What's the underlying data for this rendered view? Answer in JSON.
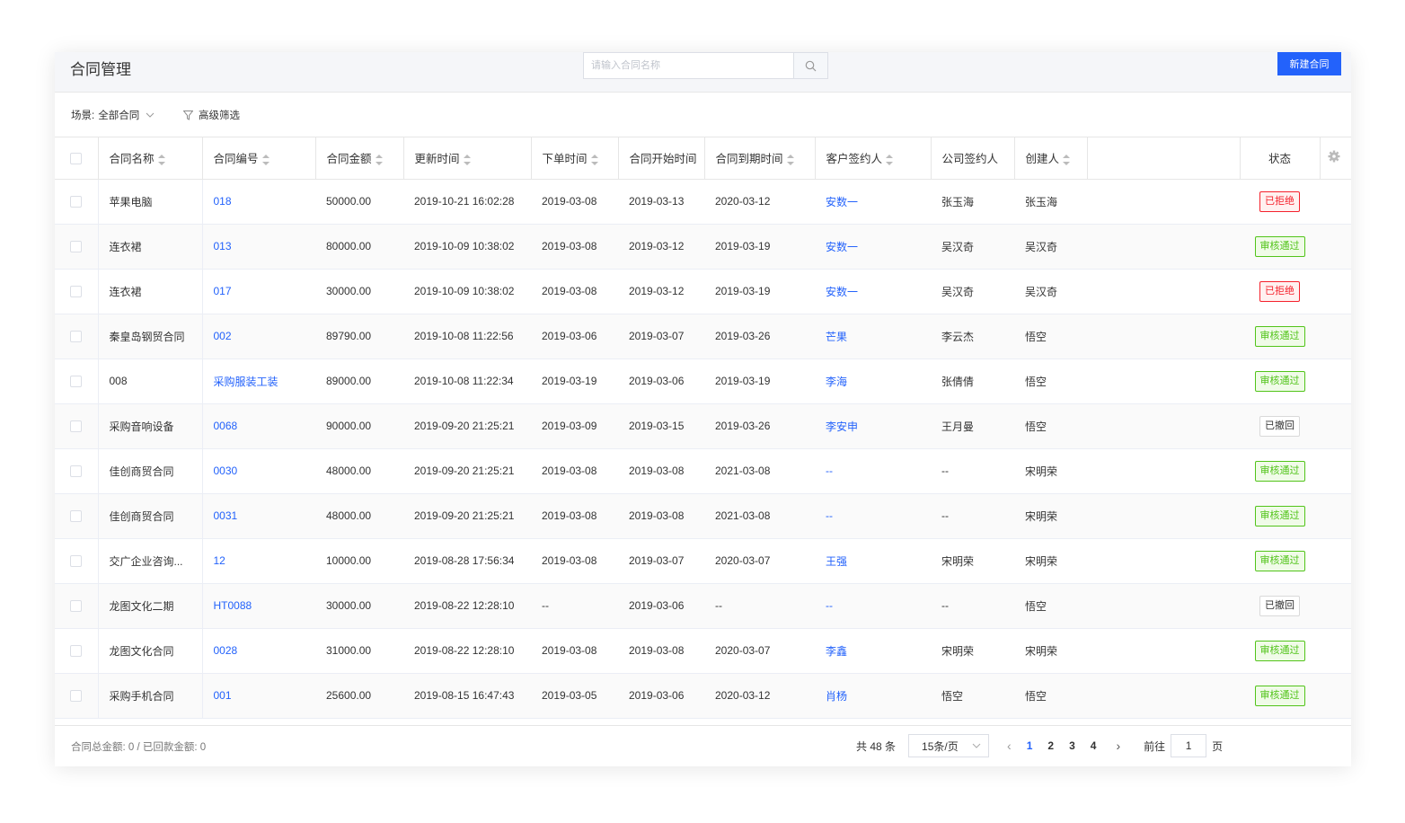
{
  "header": {
    "title": "合同管理",
    "search_placeholder": "请输入合同名称",
    "new_button": "新建合同"
  },
  "filters": {
    "scene_label": "场景:",
    "scene_value": "全部合同",
    "advanced": "高级筛选"
  },
  "columns": [
    "合同名称",
    "合同编号",
    "合同金额",
    "更新时间",
    "下单时间",
    "合同开始时间",
    "合同到期时间",
    "客户签约人",
    "公司签约人",
    "创建人",
    "状态"
  ],
  "rows": [
    [
      "苹果电脑",
      "018",
      "50000.00",
      "2019-10-21 16:02:28",
      "2019-03-08",
      "2019-03-13",
      "2020-03-12",
      "安数一",
      "张玉海",
      "张玉海",
      "已拒绝"
    ],
    [
      "连衣裙",
      "013",
      "80000.00",
      "2019-10-09 10:38:02",
      "2019-03-08",
      "2019-03-12",
      "2019-03-19",
      "安数一",
      "吴汉奇",
      "吴汉奇",
      "审核通过"
    ],
    [
      "连衣裙",
      "017",
      "30000.00",
      "2019-10-09 10:38:02",
      "2019-03-08",
      "2019-03-12",
      "2019-03-19",
      "安数一",
      "吴汉奇",
      "吴汉奇",
      "已拒绝"
    ],
    [
      "秦皇岛钢贸合同",
      "002",
      "89790.00",
      "2019-10-08 11:22:56",
      "2019-03-06",
      "2019-03-07",
      "2019-03-26",
      "芒果",
      "李云杰",
      "悟空",
      "审核通过"
    ],
    [
      "008",
      "采购服装工装",
      "89000.00",
      "2019-10-08 11:22:34",
      "2019-03-19",
      "2019-03-06",
      "2019-03-19",
      "李海",
      "张倩倩",
      "悟空",
      "审核通过"
    ],
    [
      "采购音响设备",
      "0068",
      "90000.00",
      "2019-09-20 21:25:21",
      "2019-03-09",
      "2019-03-15",
      "2019-03-26",
      "李安申",
      "王月曼",
      "悟空",
      "已撤回"
    ],
    [
      "佳创商贸合同",
      "0030",
      "48000.00",
      "2019-09-20 21:25:21",
      "2019-03-08",
      "2019-03-08",
      "2021-03-08",
      "--",
      "--",
      "宋明荣",
      "审核通过"
    ],
    [
      "佳创商贸合同",
      "0031",
      "48000.00",
      "2019-09-20 21:25:21",
      "2019-03-08",
      "2019-03-08",
      "2021-03-08",
      "--",
      "--",
      "宋明荣",
      "审核通过"
    ],
    [
      "交广企业咨询...",
      "12",
      "10000.00",
      "2019-08-28 17:56:34",
      "2019-03-08",
      "2019-03-07",
      "2020-03-07",
      "王强",
      "宋明荣",
      "宋明荣",
      "审核通过"
    ],
    [
      "龙图文化二期",
      "HT0088",
      "30000.00",
      "2019-08-22 12:28:10",
      "--",
      "2019-03-06",
      "--",
      "--",
      "--",
      "悟空",
      "已撤回"
    ],
    [
      "龙图文化合同",
      "0028",
      "31000.00",
      "2019-08-22 12:28:10",
      "2019-03-08",
      "2019-03-08",
      "2020-03-07",
      "李鑫",
      "宋明荣",
      "宋明荣",
      "审核通过"
    ],
    [
      "采购手机合同",
      "001",
      "25600.00",
      "2019-08-15 16:47:43",
      "2019-03-05",
      "2019-03-06",
      "2020-03-12",
      "肖杨",
      "悟空",
      "悟空",
      "审核通过"
    ]
  ],
  "footer": {
    "summary": "合同总金额: 0 / 已回款金额: 0",
    "total": "共 48 条",
    "page_size": "15条/页",
    "pages": [
      "1",
      "2",
      "3",
      "4"
    ],
    "current_page": "1",
    "goto_label": "前往",
    "goto_value": "1",
    "page_suffix": "页"
  },
  "status_colors": {
    "审核通过": "#52c41a",
    "已拒绝": "#f5222d",
    "已撤回": "#333333"
  },
  "accent_color": "#2362fb"
}
